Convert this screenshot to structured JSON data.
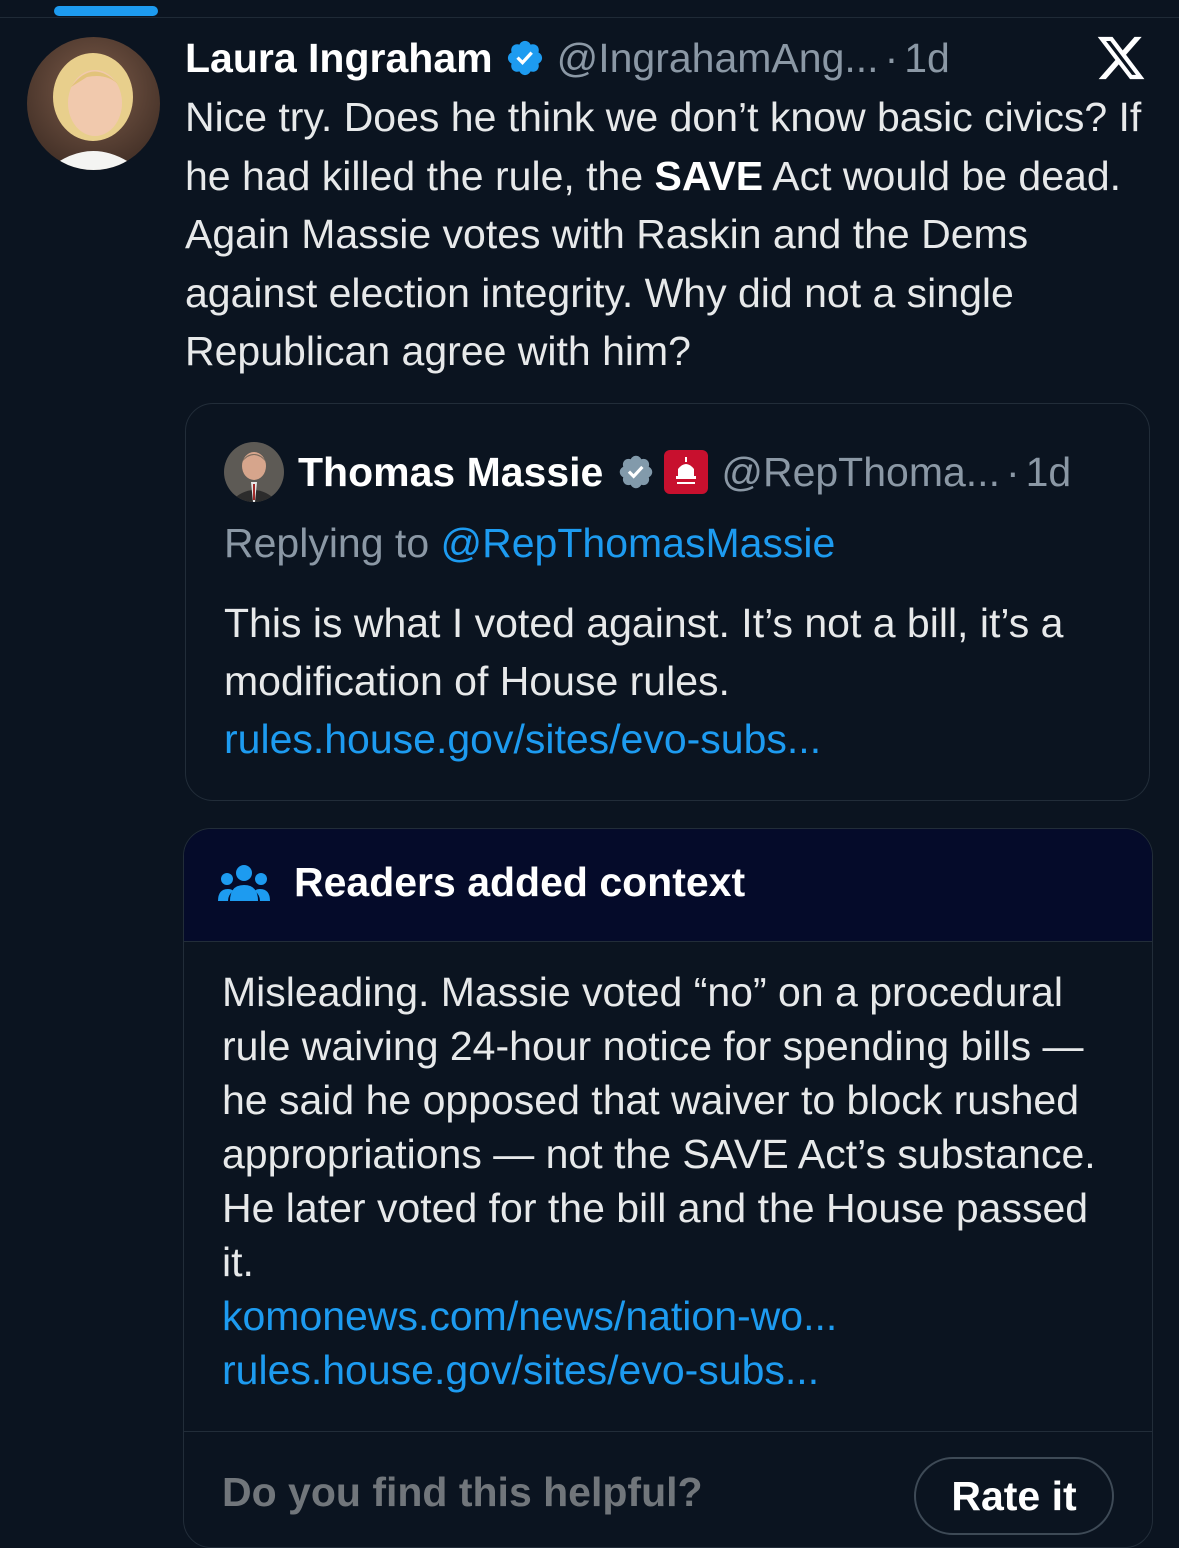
{
  "tweet": {
    "author_name": "Laura Ingraham",
    "handle": "@IngrahamAng...",
    "separator": "·",
    "time": "1d",
    "text_parts": {
      "before_bold": "Nice try.  Does he think we don’t know basic civics?  If he had killed the rule, the ",
      "bold": "SAVE",
      "after_bold": " Act would be dead.  Again Massie votes with Raskin and the Dems against election integrity.  Why did not a single Republican agree with him?"
    }
  },
  "quoted_tweet": {
    "author_name": "Thomas Massie",
    "handle": "@RepThoma...",
    "separator": "·",
    "time": "1d",
    "replying_prefix": "Replying to ",
    "replying_to": "@RepThomasMassie",
    "text": "This is what I voted against. It’s not a bill, it’s a modification of House rules.",
    "link": "rules.house.gov/sites/evo-subs..."
  },
  "community_note": {
    "title": "Readers added context",
    "body": "Misleading. Massie voted “no” on a procedural rule waiving 24-hour notice for spending bills — he said he opposed that waiver to block rushed appropriations — not the SAVE Act’s substance. He later voted for the bill and the House passed it.",
    "links": [
      "komonews.com/news/nation-wo...",
      "rules.house.gov/sites/evo-subs..."
    ],
    "helpful_prompt": "Do you find this helpful?",
    "rate_label": "Rate it"
  },
  "icons": {
    "verified": "verified-badge-icon",
    "x_logo": "x-logo-icon",
    "readers": "people-group-icon",
    "affiliation": "house-gop-badge-icon"
  },
  "colors": {
    "background": "#0b1420",
    "accent": "#1d9bf0",
    "note_header": "#050b2a",
    "muted_text": "#8b98a5"
  }
}
